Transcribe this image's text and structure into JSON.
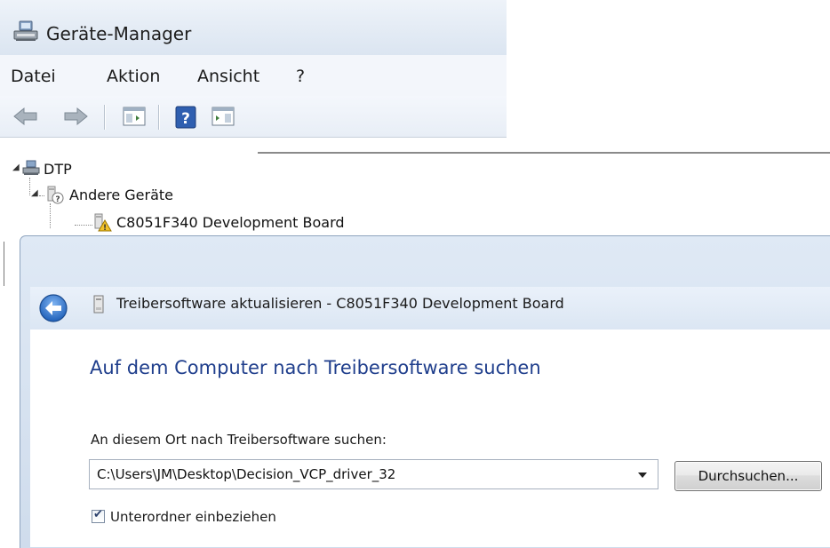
{
  "device_manager": {
    "title": "Geräte-Manager",
    "menu": [
      "Datei",
      "Aktion",
      "Ansicht",
      "?"
    ],
    "toolbar": [
      "back-arrow-icon",
      "forward-arrow-icon",
      "show-hide-console-tree-icon",
      "help-icon",
      "show-action-pane-icon"
    ],
    "tree": {
      "root": "DTP",
      "category": "Andere Geräte",
      "device": "C8051F340 Development Board"
    }
  },
  "wizard": {
    "window_title": "Treibersoftware aktualisieren - C8051F340 Development Board",
    "heading": "Auf dem Computer nach Treibersoftware suchen",
    "location_label": "An diesem Ort nach Treibersoftware suchen:",
    "path_value": "C:\\Users\\JM\\Desktop\\Decision_VCP_driver_32",
    "browse_label": "Durchsuchen...",
    "include_subfolders_label": "Unterordner einbeziehen",
    "include_subfolders_checked": true
  },
  "colors": {
    "heading_blue": "#1f3e8c",
    "title_gradient_top": "#eef3f9",
    "title_gradient_bottom": "#dbe5f1"
  }
}
